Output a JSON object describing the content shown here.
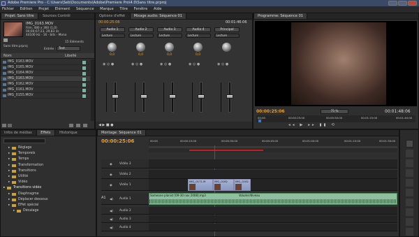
{
  "titlebar": {
    "title": "Adobe Premiere Pro - C:\\Users\\Seb\\Documents\\Adobe\\Premiere Pro\\4.0\\Sans titre.prproj"
  },
  "menu": [
    "Fichier",
    "Edition",
    "Projet",
    "Elément",
    "Séquence",
    "Marque",
    "Titre",
    "Fenêtre",
    "Aide"
  ],
  "project": {
    "tabs": [
      "Projet: Sans titre",
      "Sources Contrôl",
      "Options d'effet",
      "Mixage audio: Séquence 01"
    ],
    "clip_name": "IMG_0163.MOV",
    "clip_info": [
      "Film, 480 x 360 (1,0)",
      "00;00;07;23, 29,83 i/s",
      "44100 Hz - 16 - bits - Mono"
    ],
    "project_file": "Sans titre.prproj",
    "count": "15 Eléments",
    "entries_label": "Entrée :",
    "entries_value": "Tout",
    "col_name": "Nom",
    "col_label": "Libellé",
    "items": [
      "IMG_0163.MOV",
      "IMG_0165.MOV",
      "IMG_0164.MOV",
      "IMG_0163.MOV",
      "IMG_0162.MOV",
      "IMG_0161.MOV",
      "IMG_0155.MOV"
    ]
  },
  "mixer": {
    "timecode_left": "00:00:25:06",
    "timecode_right": "00:01:46:06",
    "channels": [
      {
        "name": "Audio 1",
        "mode": "Lecture",
        "value": "0,0"
      },
      {
        "name": "Audio 2",
        "mode": "Lecture",
        "value": "0,0"
      },
      {
        "name": "Audio 3",
        "mode": "Lecture",
        "value": "0,0"
      },
      {
        "name": "Audio 4",
        "mode": "Lecture",
        "value": "0,0"
      },
      {
        "name": "Principal",
        "mode": "Lecture",
        "value": ""
      }
    ]
  },
  "program": {
    "tab": "Programme: Séquence 01",
    "timecode": "00:00:25:06",
    "zoom": "75 %",
    "duration": "00:01:48:06",
    "ruler": [
      "00;00",
      "00:00:25:00",
      "00:00:50:00",
      "00:01:15:00",
      "00:01:40:00"
    ]
  },
  "effects": {
    "tabs": [
      "Infos de médias",
      "Effets",
      "Historique"
    ],
    "items": [
      {
        "label": "Réglage",
        "indent": 1
      },
      {
        "label": "Temporels",
        "indent": 1
      },
      {
        "label": "Temps",
        "indent": 1
      },
      {
        "label": "Transformation",
        "indent": 1
      },
      {
        "label": "Transitions",
        "indent": 1
      },
      {
        "label": "Utilité",
        "indent": 1
      },
      {
        "label": "Vidéo",
        "indent": 1
      },
      {
        "label": "Transitions vidéo",
        "indent": 0
      },
      {
        "label": "Diaphragme",
        "indent": 1
      },
      {
        "label": "Déplacer dessous",
        "indent": 1
      },
      {
        "label": "Effet spécial",
        "indent": 1
      },
      {
        "label": "Décalage",
        "indent": 2
      }
    ]
  },
  "timeline": {
    "tab": "Montage: Séquence 01",
    "timecode": "00:00:25:06",
    "ruler": [
      "00:00",
      "00:00:15:00",
      "00:00:30:00",
      "00:00:45:00",
      "00:01:00:00",
      "00:01:15:00",
      "00:01:30:00"
    ],
    "tracks": [
      {
        "name": "Vidéo 3",
        "type": "video"
      },
      {
        "name": "Vidéo 2",
        "type": "video"
      },
      {
        "name": "Vidéo 1",
        "type": "video"
      },
      {
        "name": "Audio 1",
        "type": "audio"
      },
      {
        "name": "Audio 2",
        "type": "audio"
      },
      {
        "name": "Audio 3",
        "type": "audio"
      },
      {
        "name": "Audio 4",
        "type": "audio"
      }
    ],
    "track_target": "A1",
    "video_clips": [
      "IMG_0171.M",
      "IMG_0162",
      "IMG_0162"
    ],
    "audio_clip": "Someone planist [09-30 nov 2008].mp3",
    "audio_clip_fx": "Volume:Niveau"
  },
  "colors": {
    "accent": "#e8a030",
    "label_green": "#79b59d",
    "playhead": "#d02020"
  }
}
